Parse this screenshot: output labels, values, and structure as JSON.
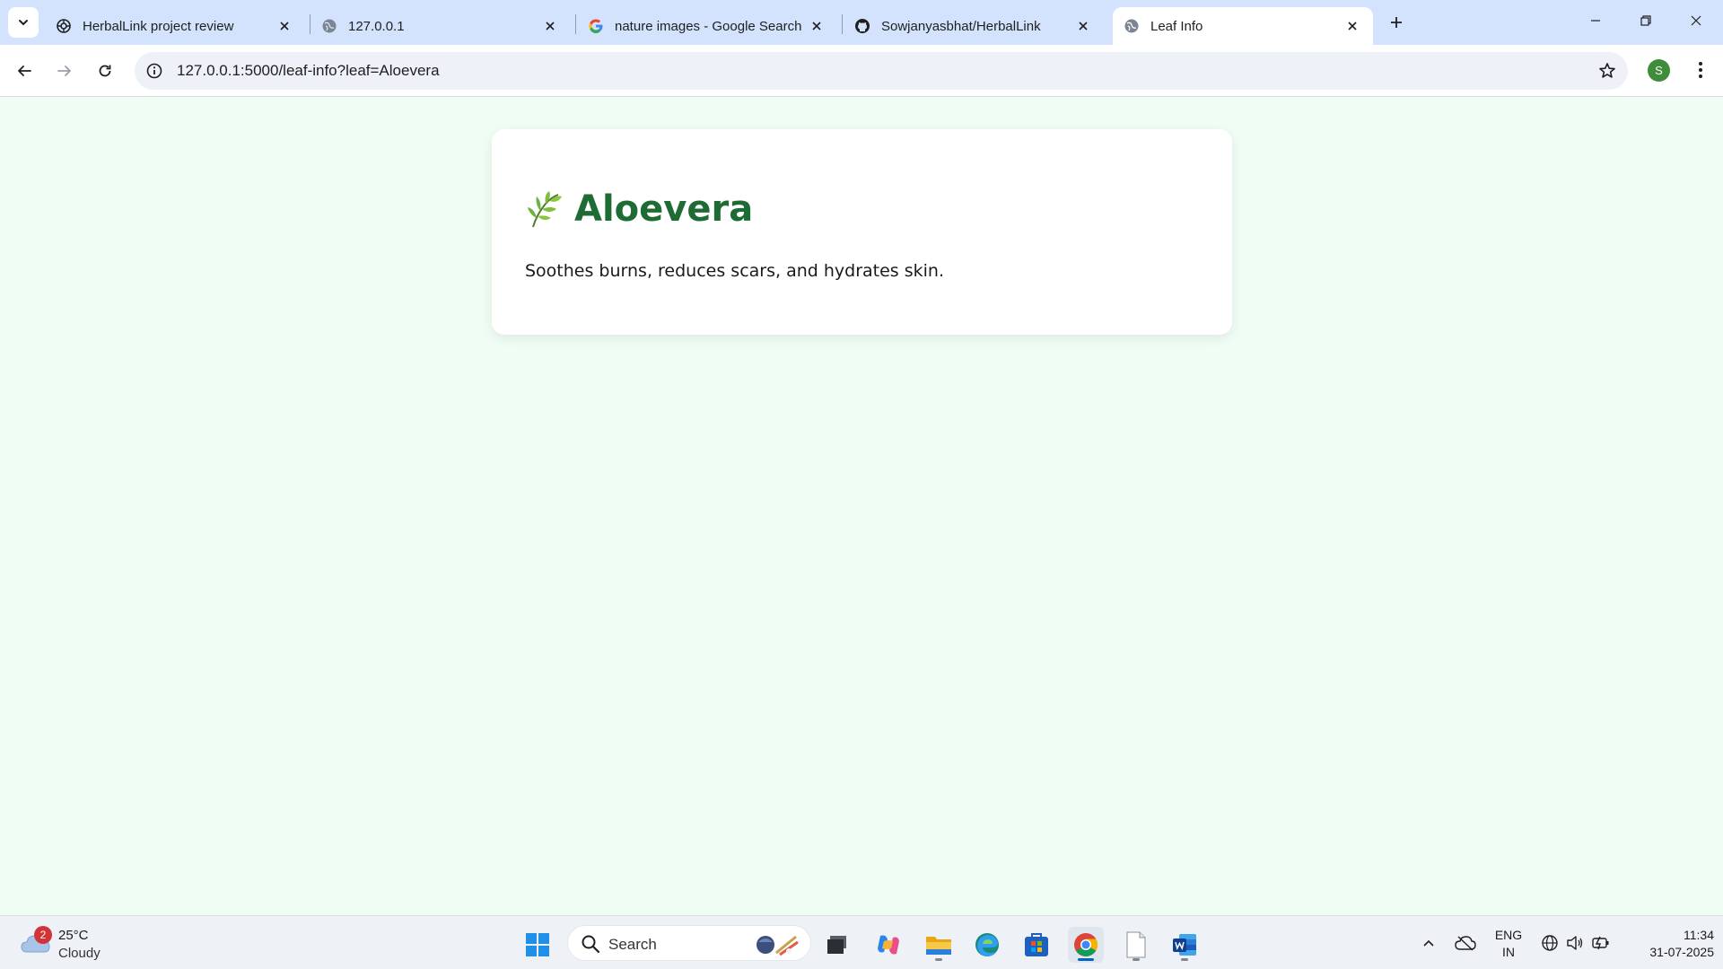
{
  "browser": {
    "tabs": [
      {
        "title": "HerbalLink project review",
        "icon": "openai-icon",
        "active": false
      },
      {
        "title": "127.0.0.1",
        "icon": "globe-icon",
        "active": false
      },
      {
        "title": "nature images - Google Search",
        "icon": "google-icon",
        "active": false
      },
      {
        "title": "Sowjanyasbhat/HerbalLink",
        "icon": "github-icon",
        "active": false
      },
      {
        "title": "Leaf Info",
        "icon": "globe-icon",
        "active": true
      }
    ],
    "url": "127.0.0.1:5000/leaf-info?leaf=Aloevera",
    "profile_initial": "S"
  },
  "page": {
    "leaf_icon": "🌿",
    "title": "Aloevera",
    "description": "Soothes burns, reduces scars, and hydrates skin."
  },
  "taskbar": {
    "weather": {
      "badge": "2",
      "temperature": "25°C",
      "condition": "Cloudy"
    },
    "search_placeholder": "Search",
    "language": {
      "line1": "ENG",
      "line2": "IN"
    },
    "clock": {
      "time": "11:34",
      "date": "31-07-2025"
    }
  },
  "colors": {
    "page_background": "#effdf4",
    "heading_green": "#1e6b34",
    "tabstrip": "#d3e3fd",
    "profile_green": "#3f8d3a"
  }
}
